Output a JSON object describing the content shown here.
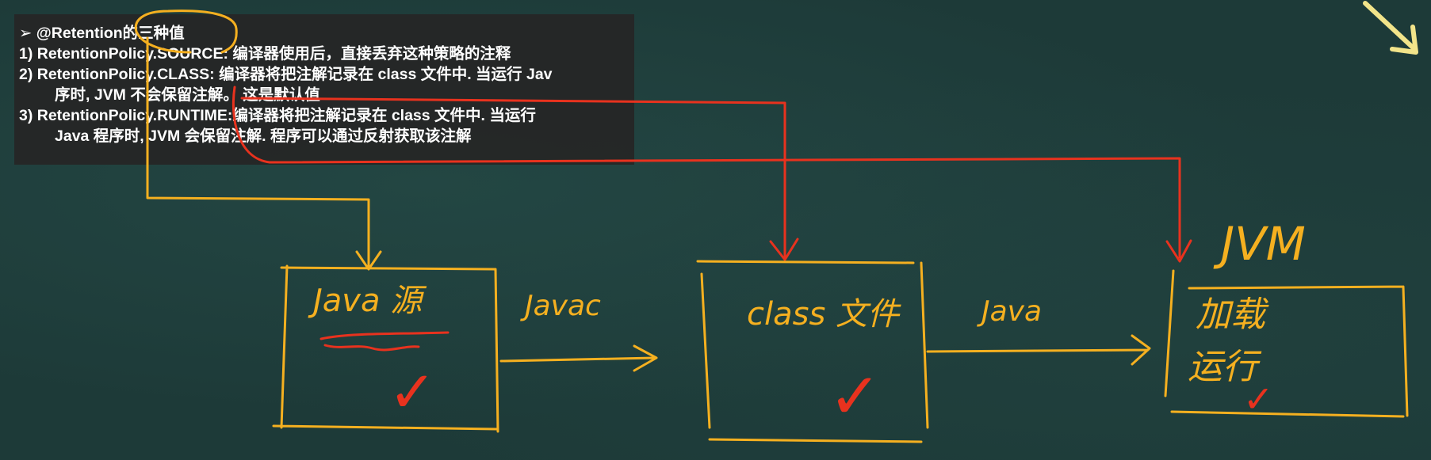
{
  "note": {
    "title": "➢ @Retention的三种值",
    "items": [
      "1) RetentionPolicy.SOURCE: 编译器使用后，直接丢弃这种策略的注释",
      "2) RetentionPolicy.CLASS: 编译器将把注解记录在 class 文件中. 当运行 Jav",
      "序时, JVM 不会保留注解。 这是默认值",
      "3) RetentionPolicy.RUNTIME:编译器将把注解记录在 class 文件中. 当运行",
      "Java 程序时, JVM 会保留注解. 程序可以通过反射获取该注解"
    ]
  },
  "diagram": {
    "box1_label": "Java 源",
    "arrow1_label": "Javac",
    "box2_label": "class 文件",
    "arrow2_label": "Java",
    "jvm_label": "JVM",
    "box3_line1": "加载",
    "box3_line2": "运行",
    "check_mark": "✓"
  },
  "colors": {
    "chalk_yellow": "#f5b020",
    "chalk_red": "#e8321e",
    "board": "#1d3a38",
    "note_bg": "#262626",
    "pointer": "#f2e48a"
  }
}
